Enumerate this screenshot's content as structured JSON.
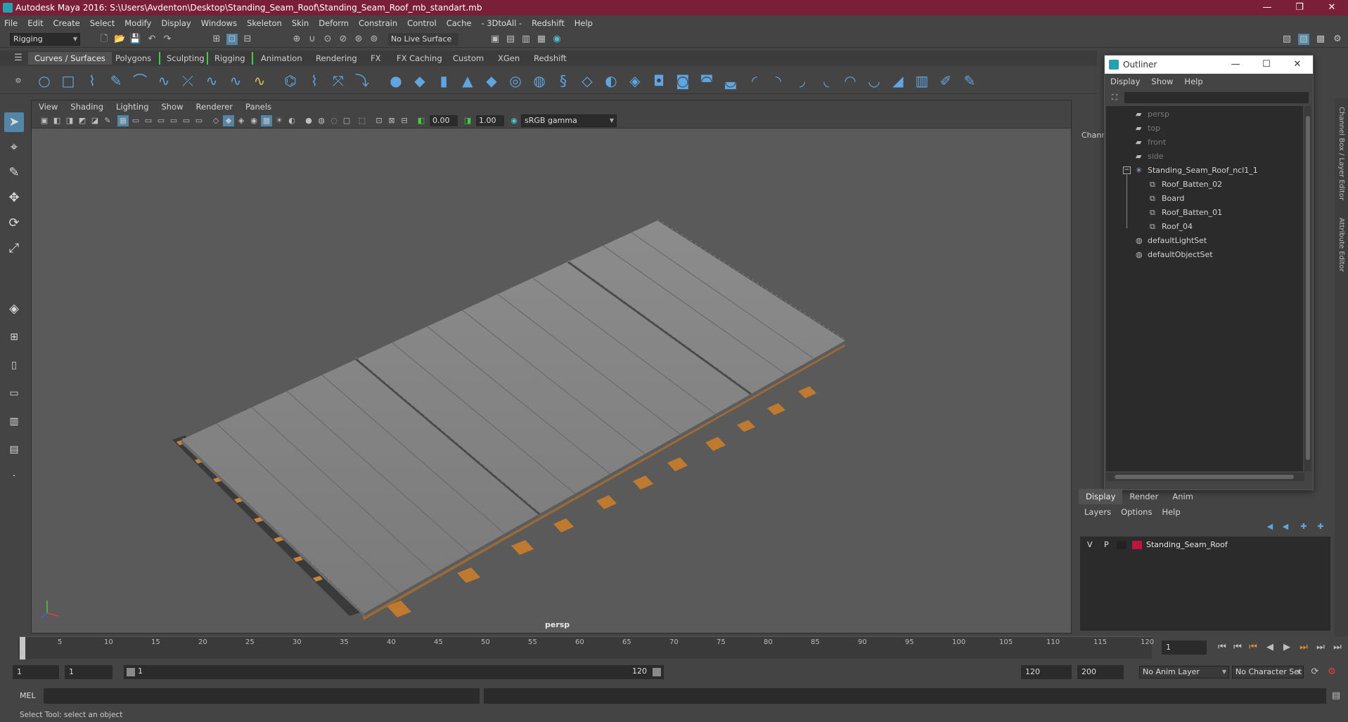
{
  "window": {
    "title": "Autodesk Maya 2016: S:\\Users\\Avdenton\\Desktop\\Standing_Seam_Roof\\Standing_Seam_Roof_mb_standart.mb",
    "minimize": "—",
    "maximize": "❐",
    "close": "✕"
  },
  "menubar": [
    "File",
    "Edit",
    "Create",
    "Select",
    "Modify",
    "Display",
    "Windows",
    "Skeleton",
    "Skin",
    "Deform",
    "Constrain",
    "Control",
    "Cache",
    "- 3DtoAll -",
    "Redshift",
    "Help"
  ],
  "statusline": {
    "mode": "Rigging",
    "live_surface": "No Live Surface"
  },
  "shelf": {
    "tabs": [
      "Curves / Surfaces",
      "Polygons",
      "Sculpting",
      "Rigging",
      "Animation",
      "Rendering",
      "FX",
      "FX Caching",
      "Custom",
      "XGen",
      "Redshift"
    ],
    "active_tab": "Curves / Surfaces"
  },
  "viewport": {
    "menu": [
      "View",
      "Shading",
      "Lighting",
      "Show",
      "Renderer",
      "Panels"
    ],
    "exposure": "0.00",
    "gamma": "1.00",
    "color_space": "sRGB gamma",
    "camera_label": "persp"
  },
  "outliner": {
    "title": "Outliner",
    "menu": [
      "Display",
      "Show",
      "Help"
    ],
    "items": [
      {
        "label": "persp",
        "icon": "camera-icon",
        "dim": true,
        "indent": 0
      },
      {
        "label": "top",
        "icon": "camera-icon",
        "dim": true,
        "indent": 0
      },
      {
        "label": "front",
        "icon": "camera-icon",
        "dim": true,
        "indent": 0
      },
      {
        "label": "side",
        "icon": "camera-icon",
        "dim": true,
        "indent": 0
      },
      {
        "label": "Standing_Seam_Roof_ncl1_1",
        "icon": "group-icon",
        "dim": false,
        "indent": 0
      },
      {
        "label": "Roof_Batten_02",
        "icon": "mesh-icon",
        "dim": false,
        "indent": 1
      },
      {
        "label": "Board",
        "icon": "mesh-icon",
        "dim": false,
        "indent": 1
      },
      {
        "label": "Roof_Batten_01",
        "icon": "mesh-icon",
        "dim": false,
        "indent": 1
      },
      {
        "label": "Roof_04",
        "icon": "mesh-icon",
        "dim": false,
        "indent": 1
      },
      {
        "label": "defaultLightSet",
        "icon": "set-icon",
        "dim": false,
        "indent": 0
      },
      {
        "label": "defaultObjectSet",
        "icon": "set-icon",
        "dim": false,
        "indent": 0
      }
    ]
  },
  "channel_box_label": "Chann",
  "side_tabs": [
    "Channel Box / Layer Editor",
    "Attribute Editor"
  ],
  "layer_editor": {
    "tabs": [
      "Display",
      "Render",
      "Anim"
    ],
    "active_tab": "Display",
    "menu": [
      "Layers",
      "Options",
      "Help"
    ],
    "layers": [
      {
        "visible": "V",
        "playback": "P",
        "color": "#c0143c",
        "name": "Standing_Seam_Roof"
      }
    ]
  },
  "timeline": {
    "ticks": [
      "1",
      "5",
      "10",
      "15",
      "20",
      "25",
      "30",
      "35",
      "40",
      "45",
      "50",
      "55",
      "60",
      "65",
      "70",
      "75",
      "80",
      "85",
      "90",
      "95",
      "100",
      "105",
      "110",
      "115",
      "120"
    ],
    "current_frame": "1"
  },
  "range": {
    "start": "1",
    "playback_start": "1",
    "slider_start": "1",
    "slider_end": "120",
    "playback_end": "120",
    "end": "200",
    "anim_layer": "No Anim Layer",
    "character_set": "No Character Set"
  },
  "cmdline": {
    "label": "MEL"
  },
  "help_line": "Select Tool: select an object"
}
